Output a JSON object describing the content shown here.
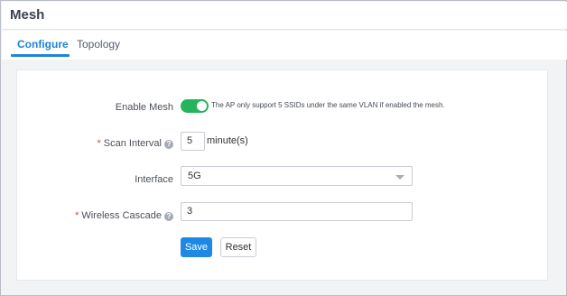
{
  "header": {
    "title": "Mesh"
  },
  "tabs": [
    {
      "label": "Configure",
      "active": true
    },
    {
      "label": "Topology",
      "active": false
    }
  ],
  "form": {
    "enable_mesh": {
      "label": "Enable Mesh",
      "enabled": true,
      "note": "The AP only support 5 SSIDs under the same VLAN if enabled the mesh."
    },
    "scan_interval": {
      "required_mark": "*",
      "label": "Scan Interval",
      "help_icon": "?",
      "value": "5",
      "unit": "minute(s)"
    },
    "interface": {
      "label": "Interface",
      "value": "5G"
    },
    "wireless_cascade": {
      "required_mark": "*",
      "label": "Wireless Cascade",
      "help_icon": "?",
      "value": "3"
    }
  },
  "buttons": {
    "save": "Save",
    "reset": "Reset"
  },
  "colors": {
    "accent": "#1f84d8",
    "toggle_on": "#25b35b",
    "required": "#e2463a",
    "save_button": "#1e88e5"
  },
  "icons": {
    "help": "question-circle-icon",
    "dropdown": "chevron-down-icon"
  }
}
